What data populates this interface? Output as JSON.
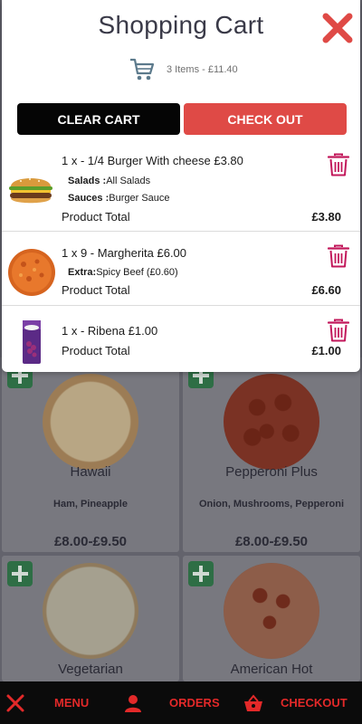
{
  "cart": {
    "title": "Shopping Cart",
    "summary": "3 Items - £11.40",
    "clear_label": "CLEAR CART",
    "checkout_label": "CHECK OUT",
    "items": [
      {
        "line": "1 x - 1/4 Burger With cheese £3.80",
        "options": [
          {
            "label": "Salads :",
            "value": "All Salads"
          },
          {
            "label": "Sauces :",
            "value": "Burger Sauce"
          }
        ],
        "total_label": "Product Total",
        "total": "£3.80",
        "image": "burger-image"
      },
      {
        "line": "1 x 9 - Margherita £6.00",
        "options": [
          {
            "label": "Extra:",
            "value": "Spicy Beef (£0.60)"
          }
        ],
        "total_label": "Product Total",
        "total": "£6.60",
        "image": "margherita-image"
      },
      {
        "line": "1 x - Ribena £1.00",
        "options": [],
        "total_label": "Product Total",
        "total": "£1.00",
        "image": "ribena-image"
      }
    ]
  },
  "products": [
    {
      "name": "Hawaii",
      "desc": "Ham, Pineapple",
      "price": "£8.00-£9.50"
    },
    {
      "name": "Pepperoni Plus",
      "desc": "Onion, Mushrooms, Pepperoni",
      "price": "£8.00-£9.50"
    },
    {
      "name": "Vegetarian",
      "desc": "",
      "price": ""
    },
    {
      "name": "American Hot",
      "desc": "",
      "price": ""
    }
  ],
  "nav": {
    "menu_label": "MENU",
    "orders_label": "ORDERS",
    "checkout_label": "CHECKOUT"
  },
  "colors": {
    "accent_red": "#df4a46",
    "nav_red": "#e32929",
    "trash_pink": "#c2185b",
    "add_green": "#2e6e45"
  }
}
